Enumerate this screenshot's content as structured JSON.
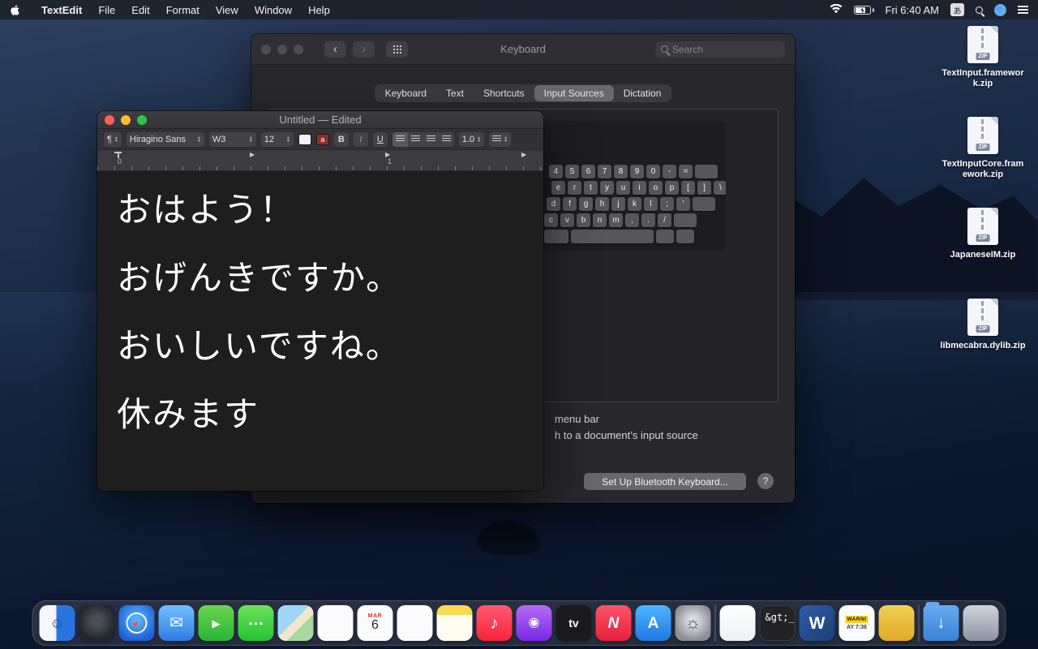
{
  "menu_bar": {
    "app_name": "TextEdit",
    "menus": [
      {
        "name": "file",
        "label": "File"
      },
      {
        "name": "edit",
        "label": "Edit"
      },
      {
        "name": "format",
        "label": "Format"
      },
      {
        "name": "view",
        "label": "View"
      },
      {
        "name": "window",
        "label": "Window"
      },
      {
        "name": "help",
        "label": "Help"
      }
    ],
    "status": {
      "clock": "Fri 6:40 AM",
      "input_menu": "あ"
    }
  },
  "keyboard_window": {
    "title": "Keyboard",
    "search_placeholder": "Search",
    "tabs": [
      {
        "name": "keyboard",
        "label": "Keyboard",
        "active": false
      },
      {
        "name": "text",
        "label": "Text",
        "active": false
      },
      {
        "name": "shortcuts",
        "label": "Shortcuts",
        "active": false
      },
      {
        "name": "input-sources",
        "label": "Input Sources",
        "active": true
      },
      {
        "name": "dictation",
        "label": "Dictation",
        "active": false
      }
    ],
    "key_rows": [
      [
        "4",
        "5",
        "6",
        "7",
        "8",
        "9",
        "0",
        "-",
        "=",
        ""
      ],
      [
        "e",
        "r",
        "t",
        "y",
        "u",
        "i",
        "o",
        "p",
        "[",
        "]",
        "\\"
      ],
      [
        "d",
        "f",
        "g",
        "h",
        "j",
        "k",
        "l",
        ";",
        "'",
        ""
      ],
      [
        "c",
        "v",
        "b",
        "n",
        "m",
        ",",
        ".",
        "/",
        ""
      ],
      [
        "",
        "",
        "",
        ""
      ]
    ],
    "checkbox_fragment_1": "menu bar",
    "checkbox_fragment_2": "h to a document’s input source",
    "setup_button_label": "Set Up Bluetooth Keyboard...",
    "help_button_label": "?"
  },
  "textedit_window": {
    "title": "Untitled — Edited",
    "toolbar": {
      "paragraph_symbol": "¶",
      "font_family": "Hiragino Sans",
      "font_style": "W3",
      "font_size": "12",
      "color_well_text": "a",
      "bold": "B",
      "italic": "I",
      "underline": "U",
      "line_spacing": "1.0"
    },
    "ruler": {
      "zero": "0",
      "one": "1"
    },
    "lines": [
      "おはよう！",
      "おげんきですか。",
      "おいしいですね。",
      "休みます"
    ]
  },
  "desktop_icons": {
    "items": [
      {
        "name": "textinput-framework-zip",
        "label": "TextInput.framework.zip",
        "badge": "ZIP"
      },
      {
        "name": "textinputcore-framework-zip",
        "label": "TextInputCore.framework.zip",
        "badge": "ZIP"
      },
      {
        "name": "japaneseim-zip",
        "label": "JapaneseIM.zip",
        "badge": "ZIP"
      },
      {
        "name": "libmecabra-dylib-zip",
        "label": "libmecabra.dylib.zip",
        "badge": "ZIP"
      }
    ]
  },
  "dock": {
    "items": [
      {
        "name": "finder",
        "glyph": "☺"
      },
      {
        "name": "launchpad",
        "glyph": ""
      },
      {
        "name": "safari",
        "glyph": "▲"
      },
      {
        "name": "mail",
        "glyph": "✉"
      },
      {
        "name": "facetime",
        "glyph": "▶"
      },
      {
        "name": "messages",
        "glyph": "…"
      },
      {
        "name": "maps",
        "glyph": ""
      },
      {
        "name": "photos",
        "glyph": ""
      },
      {
        "name": "calendar",
        "line1": "MAR",
        "line2": "6"
      },
      {
        "name": "reminders",
        "glyph": ""
      },
      {
        "name": "notes",
        "glyph": ""
      },
      {
        "name": "music",
        "glyph": "♪"
      },
      {
        "name": "podcasts",
        "glyph": "◉"
      },
      {
        "name": "tv",
        "glyph": "tv"
      },
      {
        "name": "news",
        "glyph": "N"
      },
      {
        "name": "appstore",
        "glyph": "A"
      },
      {
        "name": "sysprefs",
        "glyph": "☼"
      },
      {
        "name": "divider"
      },
      {
        "name": "textedit",
        "glyph": ""
      },
      {
        "name": "terminal",
        "glyph": "&gt;_"
      },
      {
        "name": "word",
        "glyph": "W"
      },
      {
        "name": "warning-doc",
        "line1": "WARNI",
        "line2": "AY 7:36"
      },
      {
        "name": "unarchiver",
        "glyph": ""
      },
      {
        "name": "divider"
      },
      {
        "name": "downloads",
        "glyph": "↓"
      },
      {
        "name": "trash",
        "glyph": ""
      }
    ]
  }
}
